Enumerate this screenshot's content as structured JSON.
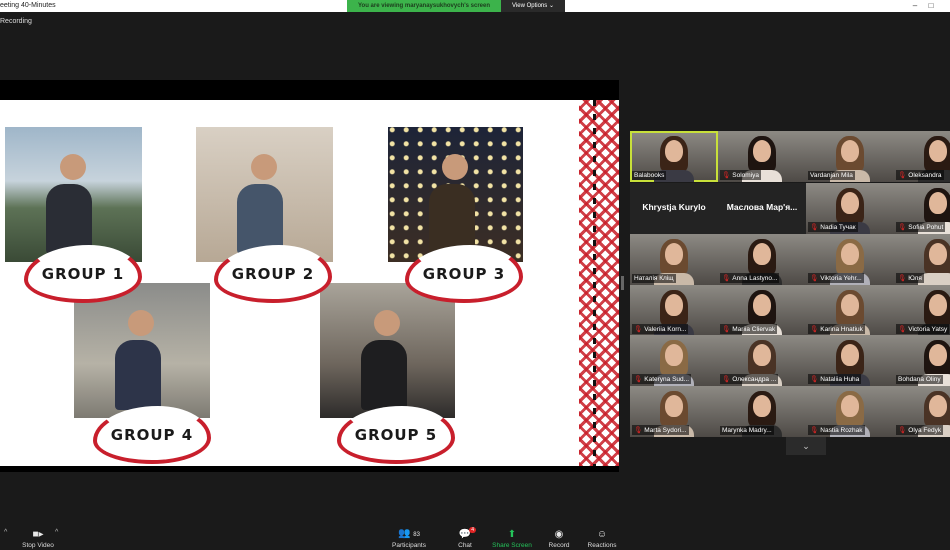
{
  "window": {
    "title": "eeting 40-Minutes",
    "banner": "You are viewing maryanaysukhovych's screen",
    "view_options": "View Options",
    "minimize": "–",
    "maximize": "□"
  },
  "status": {
    "recording": "Recording"
  },
  "slide": {
    "groups": [
      "GROUP 1",
      "GROUP 2",
      "GROUP 3",
      "GROUP 4",
      "GROUP 5"
    ],
    "accent": "#c81f2c"
  },
  "gallery": [
    {
      "name": "Balabooks",
      "muted": false
    },
    {
      "name": "Solomiya",
      "muted": true
    },
    {
      "name": "Vardanjan Mila",
      "muted": false
    },
    {
      "name": "Oleksandra",
      "muted": true
    },
    {
      "name": "Khrystja Kurylo",
      "muted": false
    },
    {
      "name": "Маслова Мар'я...",
      "muted": false
    },
    {
      "name": "Nadia Tyчак",
      "muted": true
    },
    {
      "name": "Sofiia Pohut",
      "muted": true
    },
    {
      "name": "Наталія Кліщ",
      "muted": false
    },
    {
      "name": "Anna Lastyno...",
      "muted": true
    },
    {
      "name": "Viktoria Yehr...",
      "muted": true
    },
    {
      "name": "Юля",
      "muted": true
    },
    {
      "name": "Valeriia Korn...",
      "muted": true
    },
    {
      "name": "Mariia Cliervak",
      "muted": true
    },
    {
      "name": "Karina Hnatiuk",
      "muted": true
    },
    {
      "name": "Victoria Yatsy",
      "muted": true
    },
    {
      "name": "Kateryna Sud...",
      "muted": true
    },
    {
      "name": "Олександра ...",
      "muted": true
    },
    {
      "name": "Nataliia Huha",
      "muted": true
    },
    {
      "name": "Bohdana Oliny",
      "muted": false
    },
    {
      "name": "Marta Sydori...",
      "muted": true
    },
    {
      "name": "Marynka Madry...",
      "muted": false
    },
    {
      "name": "Nastia Rozhak",
      "muted": true
    },
    {
      "name": "Olya Fedyk",
      "muted": true
    }
  ],
  "toolbar": {
    "stop_video": "Stop Video",
    "participants": "Participants",
    "participants_count": "83",
    "chat": "Chat",
    "chat_badge": "4",
    "share_screen": "Share Screen",
    "record": "Record",
    "reactions": "Reactions"
  }
}
